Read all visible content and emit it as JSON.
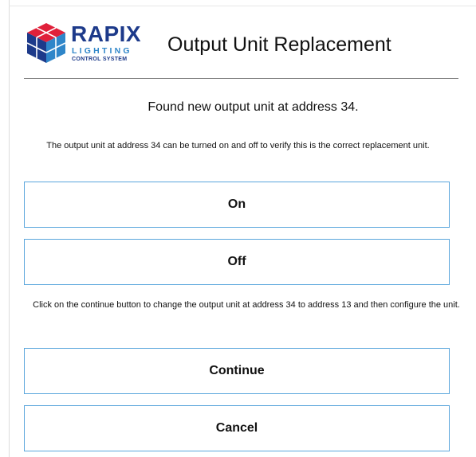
{
  "logo": {
    "word": "RAPIX",
    "line1": "LIGHTING",
    "line2": "CONTROL SYSTEM",
    "colors": {
      "navy": "#1d3a8a",
      "blue": "#2f86c9",
      "red": "#e0203a"
    }
  },
  "dialog": {
    "title": "Output Unit Replacement",
    "found_message": "Found new output unit at address 34.",
    "verify_note": "The output unit at address 34 can be turned on and off to verify this is the correct replacement unit.",
    "continue_note": "Click on the continue button to change the output unit at address 34 to address 13 and then configure the unit."
  },
  "buttons": {
    "on": "On",
    "off": "Off",
    "continue": "Continue",
    "cancel": "Cancel"
  },
  "colors": {
    "button_border": "#5aa6dc",
    "divider": "#7a7a7a"
  }
}
